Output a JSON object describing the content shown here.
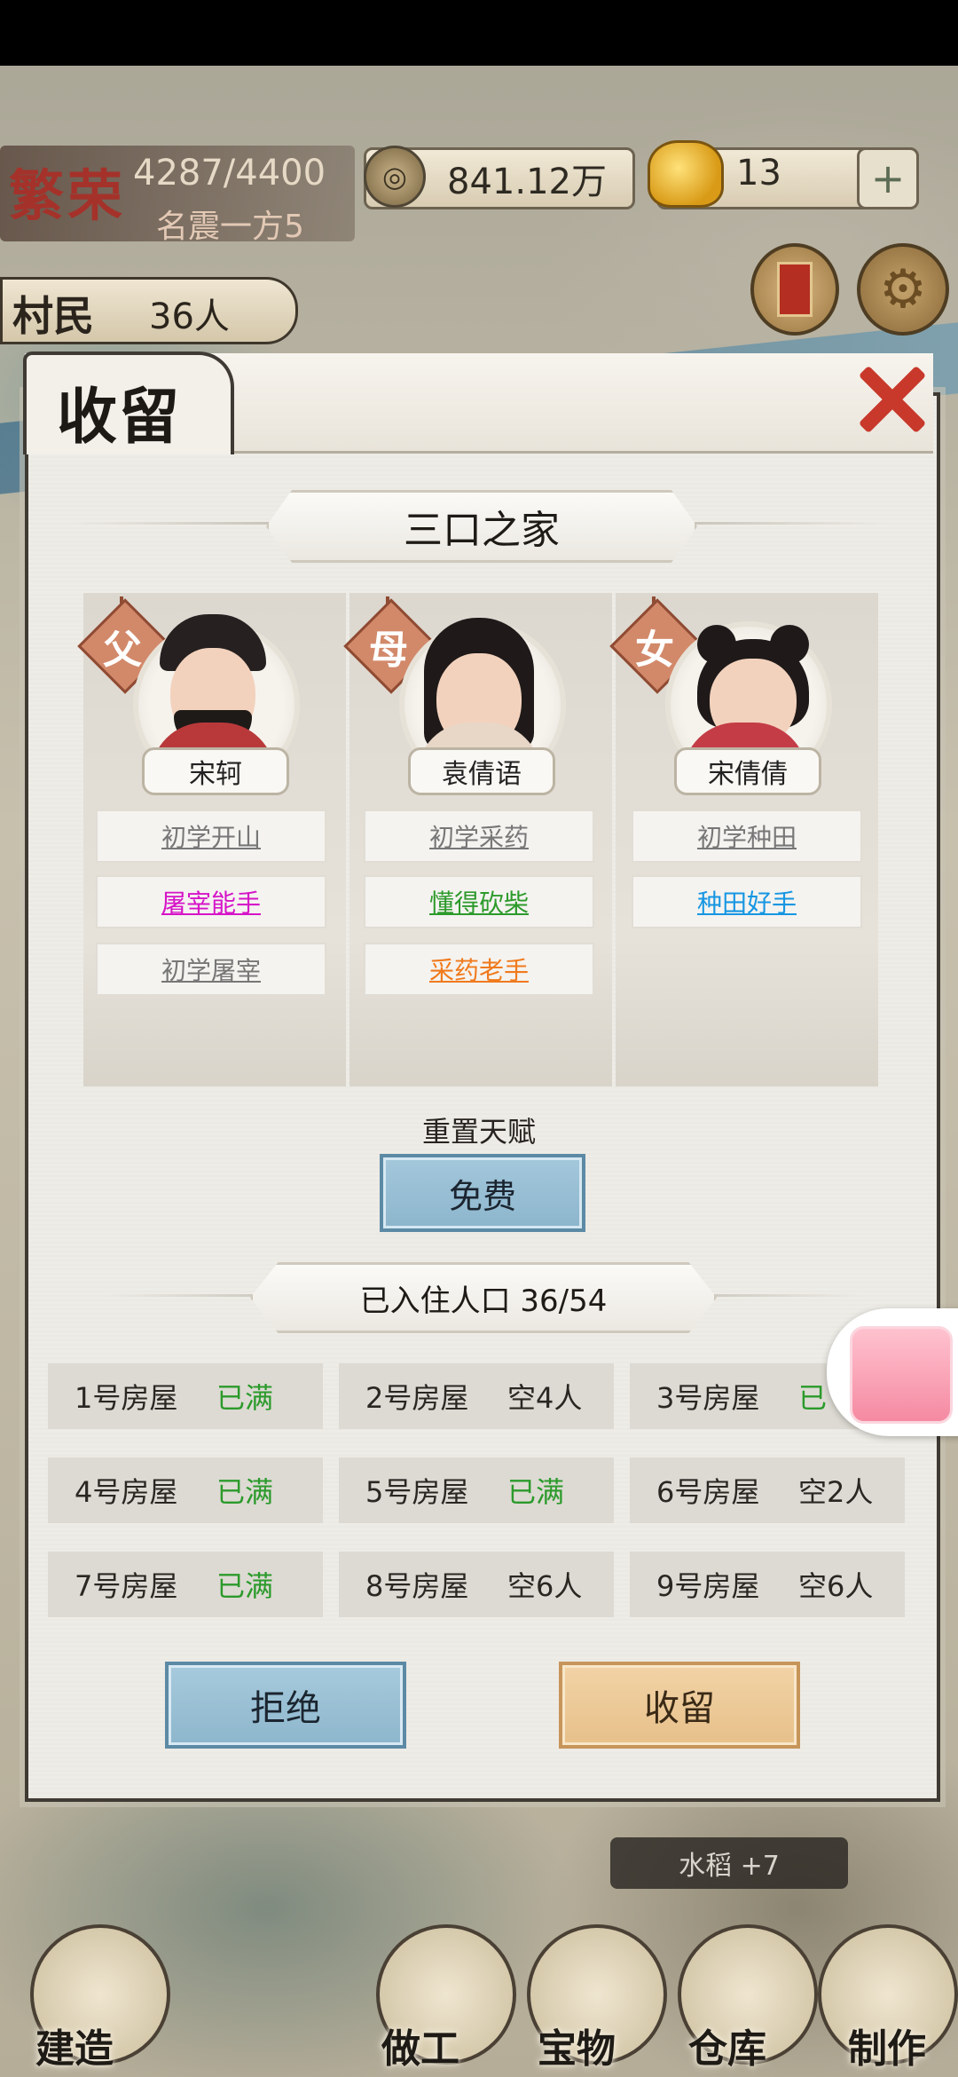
{
  "hud": {
    "fame_title": "繁荣",
    "fame_points": "4287/4400",
    "fame_rank": "名震一方5",
    "coins": "841.12万",
    "coin_symbol": "◎",
    "gold": "13",
    "plus": "+",
    "villager_label": "村民",
    "villager_count": "36人"
  },
  "dialog": {
    "title": "收留",
    "family_type": "三口之家",
    "members": [
      {
        "role": "父",
        "name": "宋轲",
        "talents": [
          {
            "text": "初学开山",
            "color": "gray"
          },
          {
            "text": "屠宰能手",
            "color": "pink"
          },
          {
            "text": "初学屠宰",
            "color": "gray"
          }
        ]
      },
      {
        "role": "母",
        "name": "袁倩语",
        "talents": [
          {
            "text": "初学采药",
            "color": "gray"
          },
          {
            "text": "懂得砍柴",
            "color": "green"
          },
          {
            "text": "采药老手",
            "color": "orange"
          }
        ]
      },
      {
        "role": "女",
        "name": "宋倩倩",
        "talents": [
          {
            "text": "初学种田",
            "color": "gray"
          },
          {
            "text": "种田好手",
            "color": "blue"
          }
        ]
      }
    ],
    "reset_label": "重置天赋",
    "free_button": "免费",
    "population_label": "已入住人口 36/54",
    "houses": [
      {
        "name": "1号房屋",
        "status": "已满",
        "full": true
      },
      {
        "name": "2号房屋",
        "status": "空4人",
        "full": false
      },
      {
        "name": "3号房屋",
        "status": "已",
        "full": true
      },
      {
        "name": "4号房屋",
        "status": "已满",
        "full": true
      },
      {
        "name": "5号房屋",
        "status": "已满",
        "full": true
      },
      {
        "name": "6号房屋",
        "status": "空2人",
        "full": false
      },
      {
        "name": "7号房屋",
        "status": "已满",
        "full": true
      },
      {
        "name": "8号房屋",
        "status": "空6人",
        "full": false
      },
      {
        "name": "9号房屋",
        "status": "空6人",
        "full": false
      }
    ],
    "reject_button": "拒绝",
    "accept_button": "收留"
  },
  "toast": {
    "harvest": "水稻 +7"
  },
  "bottom_nav": [
    {
      "label": "建造"
    },
    {
      "label": "做工"
    },
    {
      "label": "宝物"
    },
    {
      "label": "仓库"
    },
    {
      "label": "制作"
    }
  ],
  "colors": {
    "full": "#2b9a2b",
    "gray": "#777777",
    "pink": "#d614c8",
    "green": "#2d9a2b",
    "orange": "#f07a1c",
    "blue": "#1696e2"
  }
}
